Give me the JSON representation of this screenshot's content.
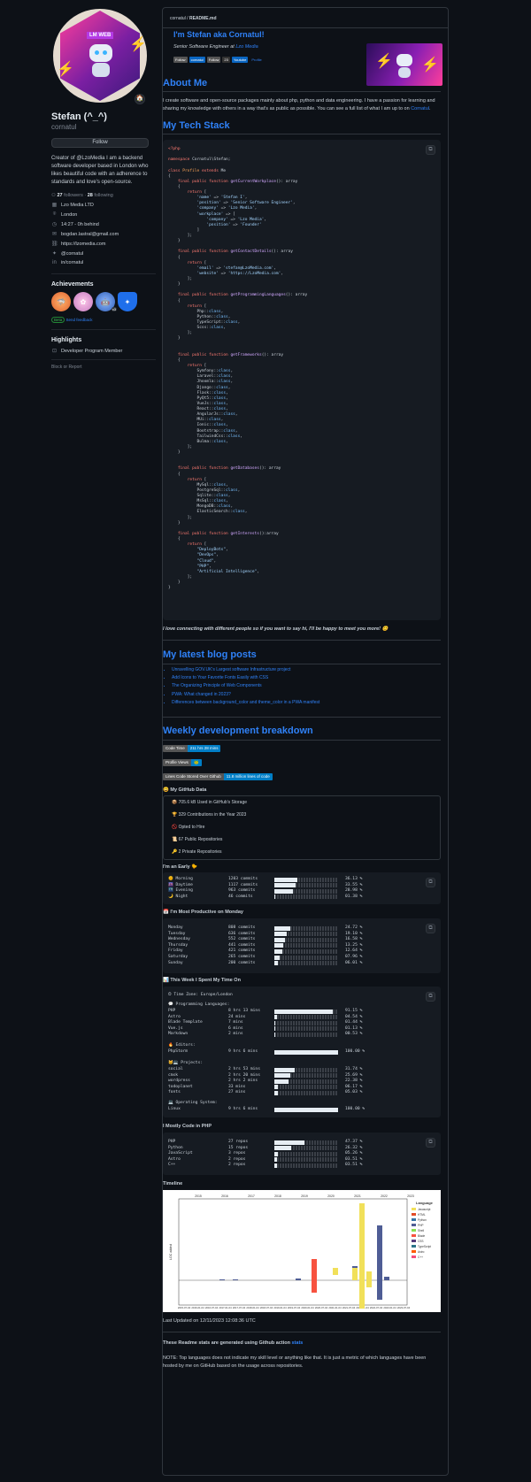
{
  "sidebar": {
    "avatar_badge": "LM WEB",
    "status_emoji": "🏠",
    "name": "Stefan (^_^)",
    "login": "cornatul",
    "follow_label": "Follow",
    "bio": "Creator of @LzoMedia I am a backend software developer based in London who likes beautiful code with an adherence to standards and love's open-source.",
    "followers_count": "27",
    "followers_label": "followers",
    "following_count": "28",
    "following_label": "following",
    "details": [
      {
        "icon": "building-icon",
        "glyph": "▦",
        "text": "Lzo Media LTD"
      },
      {
        "icon": "location-icon",
        "glyph": "⌾",
        "text": "London"
      },
      {
        "icon": "clock-icon",
        "glyph": "◷",
        "text": "14:27 - 0h behind"
      },
      {
        "icon": "mail-icon",
        "glyph": "✉",
        "text": "bogdan.lastral@gmail.com"
      },
      {
        "icon": "link-icon",
        "glyph": "⛓",
        "text": "https://lzomedia.com"
      },
      {
        "icon": "twitter-icon",
        "glyph": "✦",
        "text": "@cornatul"
      },
      {
        "icon": "linkedin-icon",
        "glyph": "in",
        "text": "in/cornatul"
      }
    ],
    "achievements_title": "Achievements",
    "achievement_multiplier": "x3",
    "beta_label": "Beta",
    "beta_link": "Send feedback",
    "highlights_title": "Highlights",
    "highlight_item": "Developer Program Member",
    "block_report": "Block or Report"
  },
  "readme": {
    "path_user": "cornatul",
    "path_file": "README.md",
    "title": "I'm Stefan aka Cornatul!",
    "subtitle_role": "Senior Software Engineer at",
    "subtitle_company": "Lzo Media",
    "header_badges": [
      "Follow",
      "cornatul",
      "Follow",
      "23",
      "Youtube"
    ],
    "profile_alt": "Profile",
    "about_title": "About Me",
    "about_text": "I create software and open-source packages mainly about php, python and data engineering. I have a passion for learning and sharing my knowledge with others in a way that's as public as possible. You can see a full list of what I am up to on",
    "about_link": "Cornatul",
    "stack_title": "My Tech Stack",
    "connect_text": "I love connecting with different people so if you want to say hi, I'll be happy to meet you more! 😊",
    "blog_title": "My latest blog posts",
    "blog_posts": [
      "Unravelling GOV.UK's Largest software Infrastructure project",
      "Add Icons to Your Favorite Fonts Easily with CSS",
      "The Organizing Principle of Web Components",
      "PWA: What changed in 2023?",
      "Differences between background_color and theme_color in a PWA manifest"
    ],
    "weekly_title": "Weekly development breakdown",
    "shield_1_left": "Code Time",
    "shield_1_right": "211 hrs 28 mins",
    "shield_2_left": "Profile Views",
    "shield_2_right": "🐸",
    "shield_3_left": "Lines of code",
    "shield_3_left_full": "Lines Code Stored Over Github",
    "shield_3_right": "11.8 million lines of code",
    "github_data_title": "😄 My GitHub Data",
    "github_data": [
      "📦 705.6 kB Used in GitHub's Storage",
      "🏆 329 Contributions in the Year 2023",
      "🚫 Opted to Hire",
      "📜 67 Public Repositories",
      "🔑 2 Private Repositories"
    ],
    "early_title": "I'm an Early 🐤",
    "early_rows": [
      {
        "label": "🌞 Morning",
        "commits": "1203 commits",
        "pct": "36.13 %",
        "value": 36.13
      },
      {
        "label": "🌆 Daytime",
        "commits": "1117 commits",
        "pct": "33.55 %",
        "value": 33.55
      },
      {
        "label": "🌃 Evening",
        "commits": "963 commits",
        "pct": "28.98 %",
        "value": 28.98
      },
      {
        "label": "🌙 Night",
        "commits": "46 commits",
        "pct": "01.38 %",
        "value": 1.38
      }
    ],
    "productive_title": "📅 I'm Most Productive on Monday",
    "productive_rows": [
      {
        "label": "Monday",
        "commits": "808 commits",
        "pct": "24.72 %",
        "value": 24.72
      },
      {
        "label": "Tuesday",
        "commits": "636 commits",
        "pct": "19.10 %",
        "value": 19.1
      },
      {
        "label": "Wednesday",
        "commits": "552 commits",
        "pct": "16.58 %",
        "value": 16.58
      },
      {
        "label": "Thursday",
        "commits": "441 commits",
        "pct": "13.25 %",
        "value": 13.25
      },
      {
        "label": "Friday",
        "commits": "421 commits",
        "pct": "12.64 %",
        "value": 12.64
      },
      {
        "label": "Saturday",
        "commits": "265 commits",
        "pct": "07.96 %",
        "value": 7.96
      },
      {
        "label": "Sunday",
        "commits": "200 commits",
        "pct": "06.01 %",
        "value": 6.01
      }
    ],
    "week_title": "📊 This Week I Spent My Time On",
    "timezone": "🕑︎ Time Zone: Europe/London",
    "languages_title": "💬 Programming Languages:",
    "languages": [
      {
        "label": "PHP",
        "time": "8 hrs 13 mins",
        "pct": "91.15 %",
        "value": 91.15
      },
      {
        "label": "Astro",
        "time": "24 mins",
        "pct": "04.54 %",
        "value": 4.54
      },
      {
        "label": "Blade Template",
        "time": "7 mins",
        "pct": "01.44 %",
        "value": 1.44
      },
      {
        "label": "Vue.js",
        "time": "6 mins",
        "pct": "01.13 %",
        "value": 1.13
      },
      {
        "label": "Markdown",
        "time": "2 mins",
        "pct": "00.53 %",
        "value": 0.53
      }
    ],
    "editors_title": "🔥 Editors:",
    "editors": [
      {
        "label": "PhpStorm",
        "time": "9 hrs 6 mins",
        "pct": "100.00 %",
        "value": 100
      }
    ],
    "projects_title": "🐱‍💻 Projects:",
    "projects": [
      {
        "label": "social",
        "time": "2 hrs 53 mins",
        "pct": "31.74 %",
        "value": 31.74
      },
      {
        "label": "cmsk",
        "time": "2 hrs 20 mins",
        "pct": "25.69 %",
        "value": 25.69
      },
      {
        "label": "wordpress",
        "time": "2 hrs 2 mins",
        "pct": "22.38 %",
        "value": 22.38
      },
      {
        "label": "todoplanet",
        "time": "33 mins",
        "pct": "06.17 %",
        "value": 6.17
      },
      {
        "label": "fonts",
        "time": "27 mins",
        "pct": "05.03 %",
        "value": 5.03
      }
    ],
    "os_title": "💻 Operating System:",
    "os": [
      {
        "label": "Linux",
        "time": "9 hrs 6 mins",
        "pct": "100.00 %",
        "value": 100
      }
    ],
    "mostly_title": "I Mostly Code in PHP",
    "mostly_rows": [
      {
        "label": "PHP",
        "repos": "27 repos",
        "pct": "47.37 %",
        "value": 47.37
      },
      {
        "label": "Python",
        "repos": "15 repos",
        "pct": "26.32 %",
        "value": 26.32
      },
      {
        "label": "JavaScript",
        "repos": "3 repos",
        "pct": "05.26 %",
        "value": 5.26
      },
      {
        "label": "Astro",
        "repos": "2 repos",
        "pct": "03.51 %",
        "value": 3.51
      },
      {
        "label": "C++",
        "repos": "2 repos",
        "pct": "03.51 %",
        "value": 3.51
      }
    ],
    "timeline_title": "Timeline",
    "last_updated": "Last Updated on 12/11/2023 12:08:36 UTC",
    "generated_text": "These Readme stats are generated using Github action",
    "generated_link": "stats",
    "note_text": "NOTE: Top languages does not indicate my skill level or anything like that. It is just a metric of which languages have been hosted by me on GitHub based on the usage across repositories."
  },
  "chart_data": {
    "type": "bar",
    "title": "",
    "ylabel": "LOC added",
    "xlabel": "",
    "years": [
      "2015",
      "2016",
      "2017",
      "2018",
      "2019",
      "2020",
      "2021",
      "2022",
      "2023"
    ],
    "legend_title": "Language",
    "legend_position": "right",
    "series": [
      {
        "name": "Javascript",
        "color": "#f1e05a"
      },
      {
        "name": "HTML",
        "color": "#e34c26"
      },
      {
        "name": "Python",
        "color": "#3572A5"
      },
      {
        "name": "PHP",
        "color": "#4F5D95"
      },
      {
        "name": "Shell",
        "color": "#89e051"
      },
      {
        "name": "Blade",
        "color": "#f7523f"
      },
      {
        "name": "CSS",
        "color": "#563d7c"
      },
      {
        "name": "TypeScript",
        "color": "#2b7489"
      },
      {
        "name": "Astro",
        "color": "#ff5a03"
      },
      {
        "name": "C++",
        "color": "#f34b7d"
      }
    ],
    "x_ticks": [
      "2015-07-04",
      "2016-01-04",
      "2016-07-04",
      "2017-01-04",
      "2017-07-04",
      "2018-01-04",
      "2018-07-04",
      "2019-01-04",
      "2019-07-04",
      "2020-01-04",
      "2020-07-04",
      "2021-01-04",
      "2021-07-04",
      "2022-01-04",
      "2022-07-04",
      "2023-01-04",
      "2023-07-04"
    ]
  }
}
